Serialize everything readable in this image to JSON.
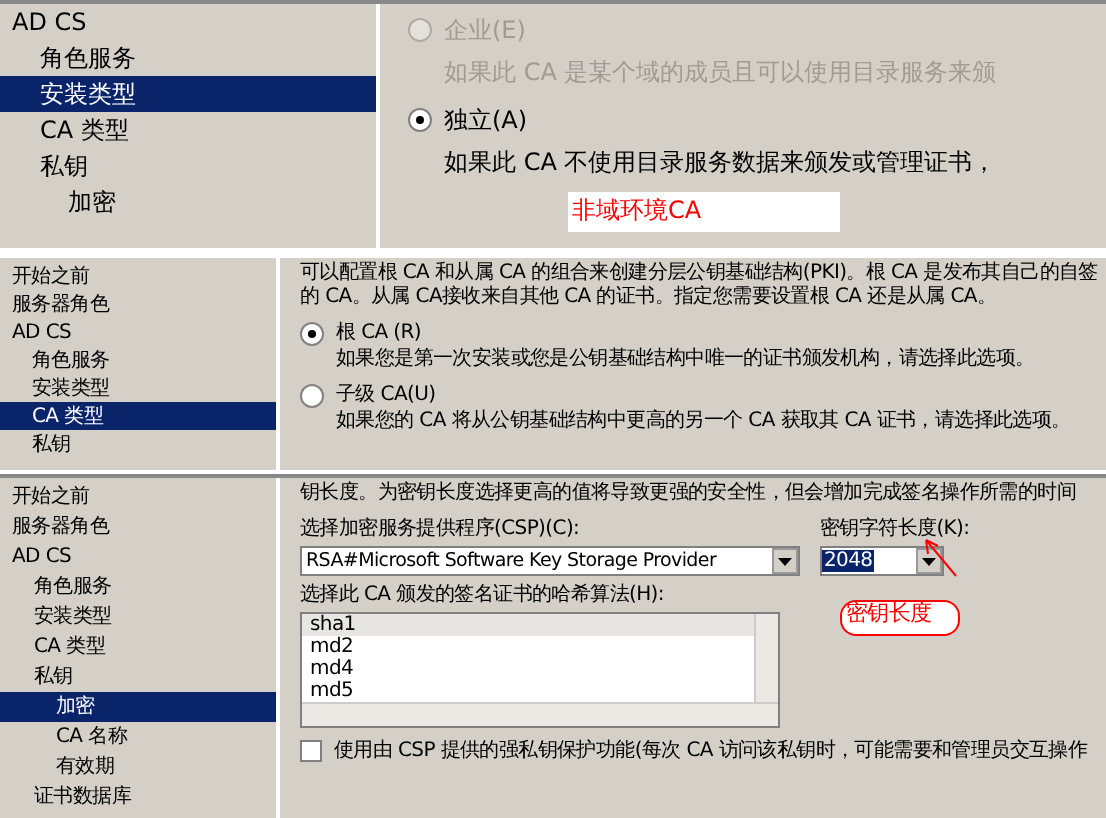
{
  "panels": [
    {
      "kind": "install_type",
      "sidebar": {
        "items": [
          {
            "label": "AD CS",
            "selected": false,
            "children": [
              {
                "label": "角色服务",
                "selected": false
              },
              {
                "label": "安装类型",
                "selected": true
              },
              {
                "label": "CA 类型",
                "selected": false
              },
              {
                "label": "私钥",
                "selected": false,
                "children": [
                  {
                    "label": "加密",
                    "selected": false
                  }
                ]
              }
            ]
          }
        ]
      },
      "options": [
        {
          "label": "企业(E)",
          "selected": false,
          "disabled": true,
          "description": "如果此 CA 是某个域的成员且可以使用目录服务来颁"
        },
        {
          "label": "独立(A)",
          "selected": true,
          "disabled": false,
          "description": "如果此 CA 不使用目录服务数据来颁发或管理证书，"
        }
      ],
      "annotation": "非域环境CA"
    },
    {
      "kind": "ca_type",
      "sidebar": {
        "items": [
          {
            "label": "开始之前",
            "selected": false
          },
          {
            "label": "服务器角色",
            "selected": false
          },
          {
            "label": "AD CS",
            "selected": false,
            "children": [
              {
                "label": "角色服务",
                "selected": false
              },
              {
                "label": "安装类型",
                "selected": false
              },
              {
                "label": "CA 类型",
                "selected": true
              },
              {
                "label": "私钥",
                "selected": false
              }
            ]
          }
        ]
      },
      "intro": [
        "可以配置根 CA 和从属 CA 的组合来创建分层公钥基础结构(PKI)。根 CA 是发布其自己的自签",
        "的 CA。从属 CA接收来自其他 CA 的证书。指定您需要设置根 CA 还是从属 CA。"
      ],
      "options": [
        {
          "label": "根 CA (R)",
          "selected": true,
          "disabled": false,
          "description": "如果您是第一次安装或您是公钥基础结构中唯一的证书颁发机构，请选择此选项。"
        },
        {
          "label": "子级 CA(U)",
          "selected": false,
          "disabled": false,
          "description": "如果您的 CA 将从公钥基础结构中更高的另一个 CA 获取其 CA 证书，请选择此选项。"
        }
      ]
    },
    {
      "kind": "cryptography",
      "sidebar": {
        "items": [
          {
            "label": "开始之前",
            "selected": false
          },
          {
            "label": "服务器角色",
            "selected": false
          },
          {
            "label": "AD CS",
            "selected": false,
            "children": [
              {
                "label": "角色服务",
                "selected": false
              },
              {
                "label": "安装类型",
                "selected": false
              },
              {
                "label": "CA 类型",
                "selected": false
              },
              {
                "label": "私钥",
                "selected": false,
                "children": [
                  {
                    "label": "加密",
                    "selected": true
                  },
                  {
                    "label": "CA 名称",
                    "selected": false
                  },
                  {
                    "label": "有效期",
                    "selected": false
                  }
                ]
              },
              {
                "label": "证书数据库",
                "selected": false
              }
            ]
          }
        ]
      },
      "intro": "钥长度。为密钥长度选择更高的值将导致更强的安全性，但会增加完成签名操作所需的时间",
      "csp": {
        "label": "选择加密服务提供程序(CSP)(C):",
        "value": "RSA#Microsoft Software Key Storage Provider"
      },
      "key_length": {
        "label": "密钥字符长度(K):",
        "value": "2048"
      },
      "hash": {
        "label": "选择此 CA 颁发的签名证书的哈希算法(H):",
        "items": [
          {
            "label": "sha1",
            "selected": true
          },
          {
            "label": "md2",
            "selected": false
          },
          {
            "label": "md4",
            "selected": false
          },
          {
            "label": "md5",
            "selected": false
          }
        ]
      },
      "strong_protection": {
        "label": "使用由 CSP 提供的强私钥保护功能(每次 CA 访问该私钥时，可能需要和管理员交互操作",
        "checked": false
      },
      "annotation": "密钥长度"
    }
  ]
}
